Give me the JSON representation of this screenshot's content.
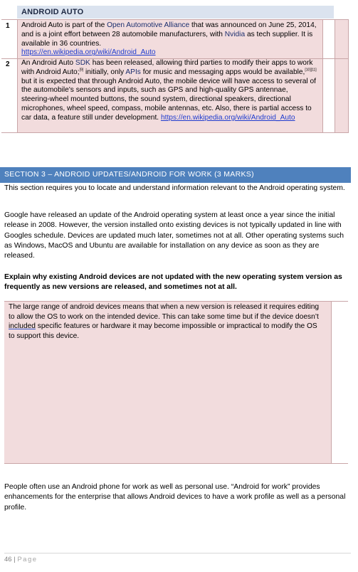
{
  "table": {
    "header": "ANDROID AUTO",
    "rows": [
      {
        "num": "1",
        "text_1": "Android Auto is part of the ",
        "link_oaa": "Open Automotive Alliance",
        "text_2": " that was announced on June 25, 2014, and is a joint effort between 28 automobile manufacturers, with ",
        "link_nvidia": "Nvidia",
        "text_3": " as tech supplier. It is available in 36 countries.",
        "url": "https://en.wikipedia.org/wiki/Android_Auto"
      },
      {
        "num": "2",
        "text_1": "An Android Auto ",
        "link_sdk": "SDK",
        "text_2": " has been released, allowing third parties to modify their apps to work with Android Auto;",
        "ref_a": "[9]",
        "text_3": " initially, only ",
        "link_apis": "APIs",
        "text_4": " for music and messaging apps would be available,",
        "ref_b": "[10][11]",
        "text_5": " but it is expected that through Android Auto, the mobile device will have access to several of the automobile's sensors and inputs, such as GPS and high-quality GPS antennae, steering-wheel mounted buttons, the sound system, directional speakers, directional microphones, wheel speed, compass, mobile antennas, etc. Also, there is partial access to car data, a feature still under development. ",
        "url": "https://en.wikipedia.org/wiki/Android_Auto"
      }
    ]
  },
  "section": {
    "heading": "SECTION 3 – ANDROID UPDATES/ANDROID FOR WORK (3 MARKS)",
    "intro": "This section requires you to locate and understand information relevant to the Android operating system.",
    "para": "Google have released an update of the Android operating system at least once a year since the initial release in 2008. However, the version installed onto existing devices is not typically updated in line with Googles schedule. Devices are updated much later, sometimes not at all. Other operating systems such as Windows, MacOS and Ubuntu are available for installation on any device as soon as they are released.",
    "question": "Explain why existing Android devices are not updated with the new operating system version as frequently as new versions are released, and sometimes not at all.",
    "answer_1": "The large range of android devices means that when a new version is released it requires editing to allow the OS to work on the intended device. This can take some time but if the device doesn’t ",
    "answer_underlined": "included",
    "answer_2": " specific features or hardware it may become impossible or impractical to modify the OS to support this device.",
    "closing": "People often use an Android phone for work as well as personal use. “Android for work” provides enhancements for the enterprise that allows Android devices to have a work profile as well as a personal profile."
  },
  "footer": {
    "page_number": "46",
    "separator": "|",
    "page_label": "Page"
  }
}
